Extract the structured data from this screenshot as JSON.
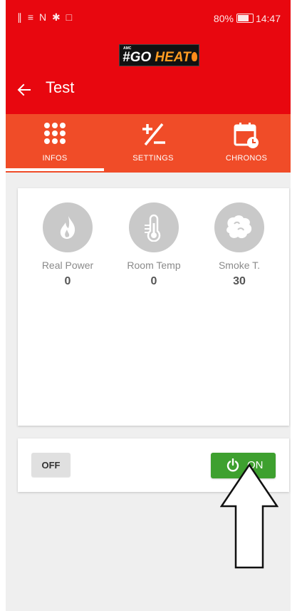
{
  "status_bar": {
    "signal_icons": "∥ ≡ N ✱ □",
    "battery_percent": "80%",
    "time": "14:47"
  },
  "logo": {
    "brand_small": "AMC",
    "text_prefix": "#GO ",
    "text_accent": "HEAT"
  },
  "toolbar": {
    "title": "Test"
  },
  "tabs": [
    {
      "label": "INFOS",
      "active": true
    },
    {
      "label": "SETTINGS",
      "active": false
    },
    {
      "label": "CHRONOS",
      "active": false
    }
  ],
  "metrics": [
    {
      "label": "Real Power",
      "value": "0",
      "icon": "flame-icon"
    },
    {
      "label": "Room Temp",
      "value": "0",
      "icon": "thermometer-icon"
    },
    {
      "label": "Smoke T.",
      "value": "30",
      "icon": "smoke-icon"
    }
  ],
  "controls": {
    "off_label": "OFF",
    "on_label": "ON"
  },
  "colors": {
    "header_red": "#e8070f",
    "tab_orange": "#f04c28",
    "on_green": "#3ea02f",
    "background": "#efefef"
  }
}
